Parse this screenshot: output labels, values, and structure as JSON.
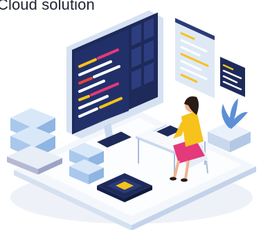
{
  "caption": {
    "text": "Cloud solution"
  },
  "colors": {
    "navy": "#1e2a5a",
    "screen_blue": "#2b3a78",
    "platform_light": "#eef4fb",
    "platform_side": "#c9d8ec",
    "cube_blue": "#b8d4f2",
    "accent_yellow": "#f6c21b",
    "accent_pink": "#e4397a",
    "accent_red": "#e8433f",
    "hair": "#2a1b16",
    "skin": "#f1b38f",
    "plant": "#5c8fd6"
  },
  "icons": [
    "monitor-icon",
    "code-window-icon",
    "small-window-icon",
    "chip-icon",
    "cube-stack-icon",
    "plant-icon",
    "person-icon",
    "desk-icon",
    "laptop-icon"
  ]
}
